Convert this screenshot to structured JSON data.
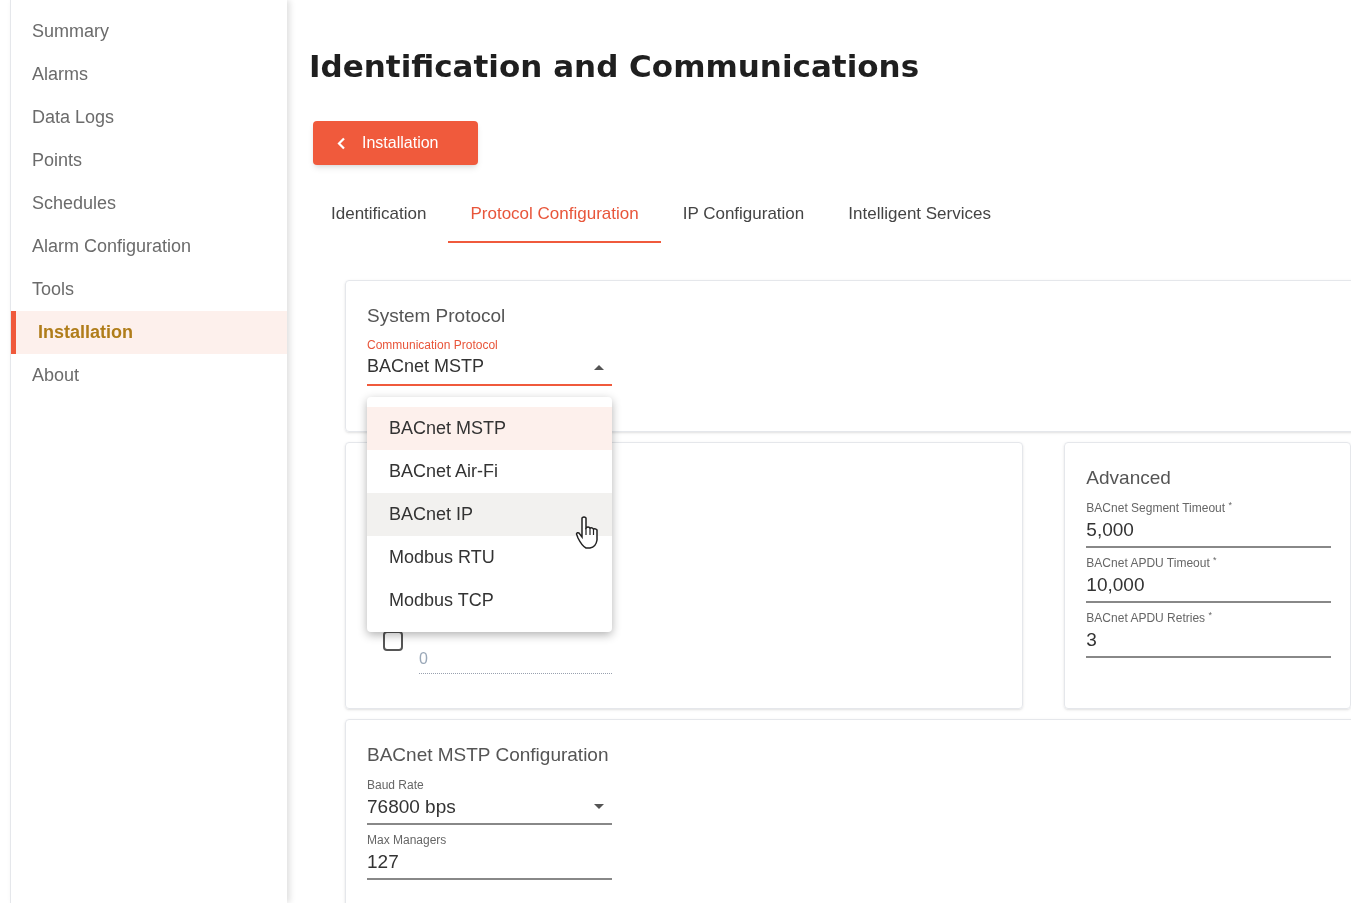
{
  "sidebar": {
    "items": [
      {
        "label": "Summary",
        "selected": false
      },
      {
        "label": "Alarms",
        "selected": false
      },
      {
        "label": "Data Logs",
        "selected": false
      },
      {
        "label": "Points",
        "selected": false
      },
      {
        "label": "Schedules",
        "selected": false
      },
      {
        "label": "Alarm Configuration",
        "selected": false
      },
      {
        "label": "Tools",
        "selected": false
      },
      {
        "label": "Installation",
        "selected": true
      },
      {
        "label": "About",
        "selected": false
      }
    ]
  },
  "page": {
    "title": "Identification and Communications"
  },
  "back_button": {
    "label": "Installation"
  },
  "tabs": [
    {
      "label": "Identification",
      "selected": false
    },
    {
      "label": "Protocol Configuration",
      "selected": true
    },
    {
      "label": "IP Configuration",
      "selected": false
    },
    {
      "label": "Intelligent Services",
      "selected": false
    }
  ],
  "system_protocol": {
    "title": "System Protocol",
    "field": {
      "label": "Communication Protocol",
      "value": "BACnet MSTP",
      "expanded": true
    },
    "options": [
      {
        "label": "BACnet MSTP",
        "selected": true,
        "hovered": false
      },
      {
        "label": "BACnet Air-Fi",
        "selected": false,
        "hovered": false
      },
      {
        "label": "BACnet IP",
        "selected": false,
        "hovered": true
      },
      {
        "label": "Modbus RTU",
        "selected": false,
        "hovered": false
      },
      {
        "label": "Modbus TCP",
        "selected": false,
        "hovered": false
      }
    ]
  },
  "device_card": {
    "checkbox": {
      "checked": false
    },
    "field": {
      "value": "0",
      "disabled": true
    }
  },
  "advanced": {
    "title": "Advanced",
    "fields": [
      {
        "label": "BACnet Segment Timeout $^{*}$",
        "value": "5,000"
      },
      {
        "label": "BACnet APDU Timeout $^{*}$",
        "value": "10,000"
      },
      {
        "label": "BACnet APDU Retries $^{*}$",
        "value": "3"
      }
    ]
  },
  "mstp": {
    "title": "BACnet MSTP Configuration",
    "fields": [
      {
        "kind": "select",
        "label": "Baud Rate",
        "value": "76800 bps"
      },
      {
        "kind": "text",
        "label": "Max Managers",
        "value": "127"
      }
    ]
  }
}
